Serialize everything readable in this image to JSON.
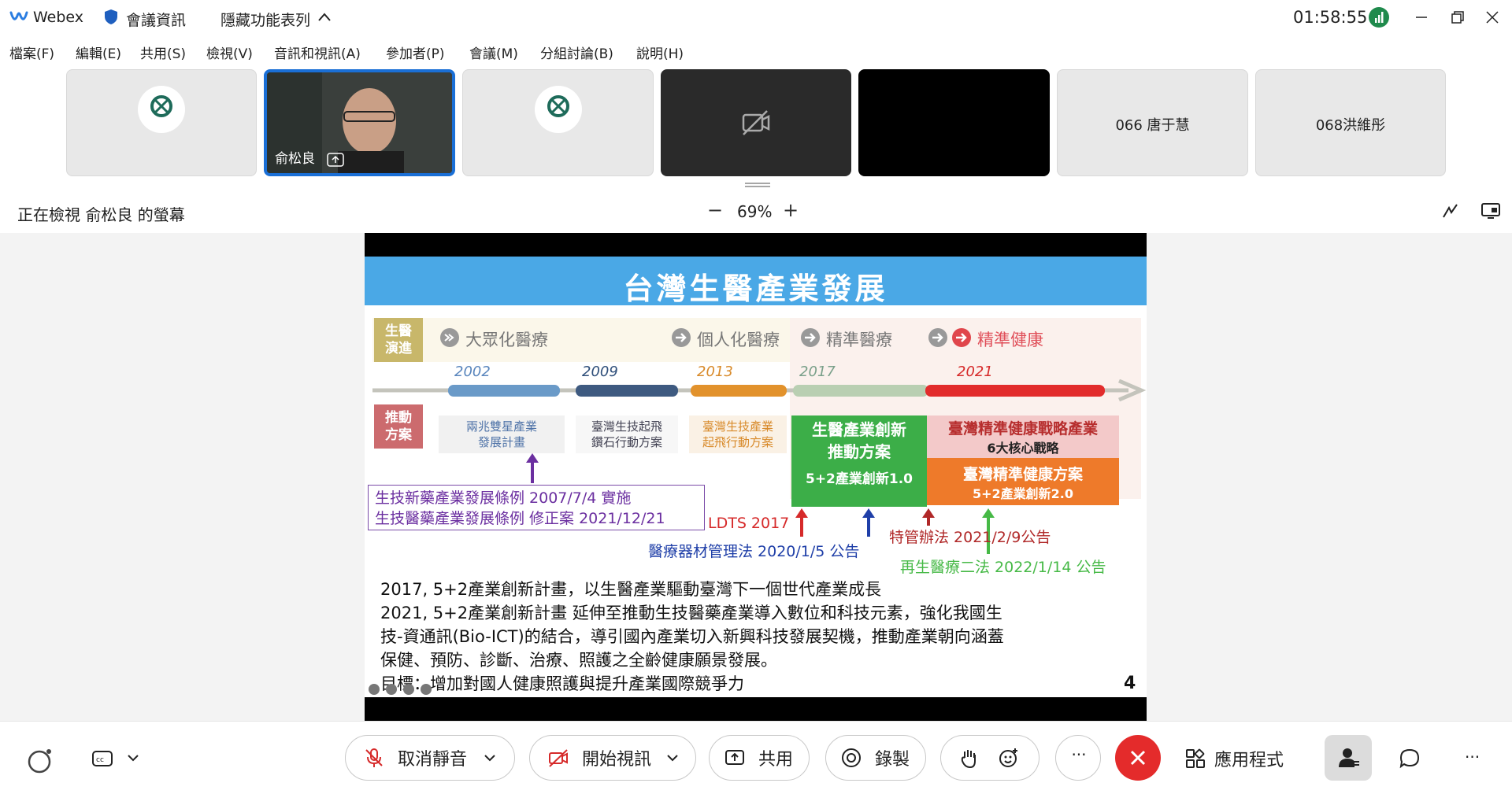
{
  "titlebar": {
    "app_name": "Webex",
    "meeting_info": "會議資訊",
    "hide_menu": "隱藏功能表列",
    "clock": "01:58:55"
  },
  "menu": [
    "檔案(F)",
    "編輯(E)",
    "共用(S)",
    "檢視(V)",
    "音訊和視訊(A)",
    "參加者(P)",
    "會議(M)",
    "分組討論(B)",
    "說明(H)"
  ],
  "participants": {
    "active_name": "俞松良",
    "tile_6": "066 唐于慧",
    "tile_7": "068洪維彤"
  },
  "share": {
    "status": "正在檢視 俞松良 的螢幕",
    "zoom_minus": "−",
    "zoom_level": "69%",
    "zoom_plus": "+"
  },
  "slide": {
    "title": "台灣生醫產業發展",
    "label_evolution": "生醫演進",
    "label_evolution_l1": "生醫",
    "label_evolution_l2": "演進",
    "label_push_l1": "推動",
    "label_push_l2": "方案",
    "eras": [
      "大眾化醫療",
      "個人化醫療",
      "精準醫療",
      "精準健康"
    ],
    "years": [
      "2002",
      "2009",
      "2013",
      "2017",
      "2021"
    ],
    "plans": [
      {
        "l1": "兩兆雙星產業",
        "l2": "發展計畫"
      },
      {
        "l1": "臺灣生技起飛",
        "l2": "鑽石行動方案"
      },
      {
        "l1": "臺灣生技產業",
        "l2": "起飛行動方案"
      }
    ],
    "green_box": {
      "l1": "生醫產業創新",
      "l2": "推動方案",
      "sub": "5+2產業創新1.0"
    },
    "pink_box": {
      "title": "臺灣精準健康戰略產業",
      "sub": "6大核心戰略"
    },
    "orange_box": {
      "title": "臺灣精準健康方案",
      "sub": "5+2產業創新2.0"
    },
    "laws": [
      "生技新藥產業發展條例 2007/7/4 實施",
      "生技醫藥產業發展條例 修正案 2021/12/21"
    ],
    "ldts": "LDTS 2017",
    "med_device_law": "醫療器材管理法 2020/1/5 公告",
    "special_law": "特管辦法 2021/2/9公告",
    "regen_law": "再生醫療二法 2022/1/14 公告",
    "body": [
      "2017, 5+2產業創新計畫，以生醫產業驅動臺灣下一個世代產業成長",
      "2021, 5+2產業創新計畫 延伸至推動生技醫藥產業導入數位和科技元素，強化我國生",
      "技-資通訊(Bio-ICT)的結合，導引國內產業切入新興科技發展契機，推動產業朝向涵蓋",
      "保健、預防、診斷、治療、照護之全齡健康願景發展。",
      "目標：增加對國人健康照護與提升產業國際競爭力"
    ],
    "page_number": "4"
  },
  "controls": {
    "unmute": "取消靜音",
    "start_video": "開始視訊",
    "share": "共用",
    "record": "錄製",
    "more": "···",
    "apps": "應用程式",
    "overflow": "···"
  },
  "colors": {
    "accent_blue": "#1a6fd6",
    "slide_title_bar": "#4aa8e6",
    "end_call": "#e42b2b",
    "green_box": "#3cae48",
    "orange_box": "#ee7a2a"
  }
}
